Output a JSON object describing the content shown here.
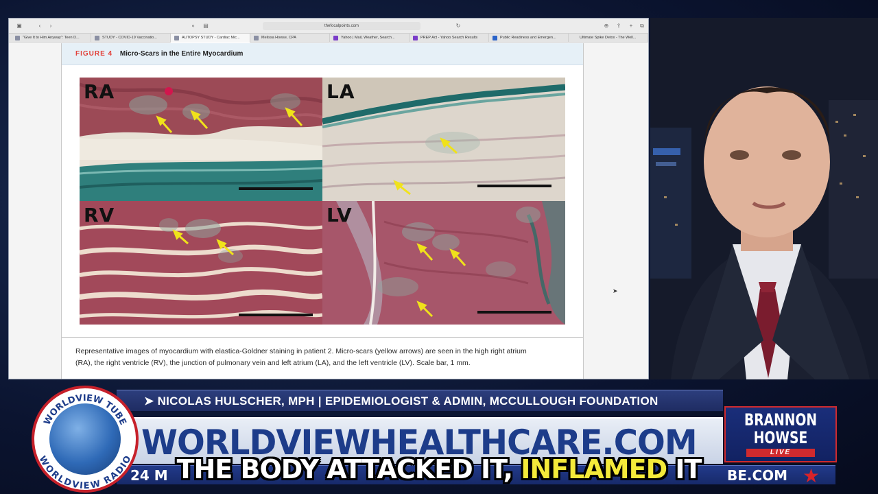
{
  "browser": {
    "url": "thefocalpoints.com",
    "tabs": [
      {
        "label": "\"Give It to Him Anyway\": Teen D...",
        "icon": "doc",
        "active": false
      },
      {
        "label": "STUDY - COVID-19 Vaccinatio...",
        "icon": "doc",
        "active": false
      },
      {
        "label": "AUTOPSY STUDY - Cardiac Mic...",
        "icon": "doc",
        "active": true
      },
      {
        "label": "Melissa Howse, CPA",
        "icon": "doc",
        "active": false
      },
      {
        "label": "Yahoo | Mail, Weather, Search...",
        "icon": "yahoo",
        "active": false
      },
      {
        "label": "PREP Act - Yahoo Search Results",
        "icon": "yahoo",
        "active": false
      },
      {
        "label": "Public Readiness and Emergen...",
        "icon": "blue",
        "active": false
      },
      {
        "label": "Ultimate Spike Detox - The Well...",
        "icon": "none",
        "active": false
      }
    ]
  },
  "figure": {
    "label": "FIGURE 4",
    "title": "Micro-Scars in the Entire Myocardium",
    "panels": [
      {
        "id": "ra",
        "label": "RA"
      },
      {
        "id": "la",
        "label": "LA"
      },
      {
        "id": "rv",
        "label": "RV"
      },
      {
        "id": "lv",
        "label": "LV"
      }
    ],
    "caption_line1": "Representative images of myocardium with elastica-Goldner staining in patient 2. Micro-scars (yellow arrows) are seen in the high right atrium",
    "caption_line2": "(RA), the right ventricle (RV), the junction of pulmonary vein and left atrium (LA), and the left ventricle (LV). Scale bar, 1 mm."
  },
  "broadcast": {
    "name_line": "➤ NICOLAS HULSCHER, MPH | EPIDEMIOLOGIST & ADMIN, MCCULLOUGH FOUNDATION",
    "website": "WORLDVIEWHEALTHCARE.COM",
    "ticker_left": "24 M",
    "ticker_right": "BE.COM",
    "logo_top": "WORLDVIEW TUBE",
    "logo_bottom": "WORLDVIEW RADIO",
    "brand_line1": "BRANNON",
    "brand_line2": "HOWSE",
    "brand_live": "LIVE",
    "subtitle_part1": "THE BODY ATTACKED IT, ",
    "subtitle_highlight": "INFLAMED",
    "subtitle_part2": " IT",
    "colors": {
      "accent_red": "#c6202a",
      "navy": "#1d3c8a",
      "highlight_yellow": "#f4ea3a"
    }
  }
}
